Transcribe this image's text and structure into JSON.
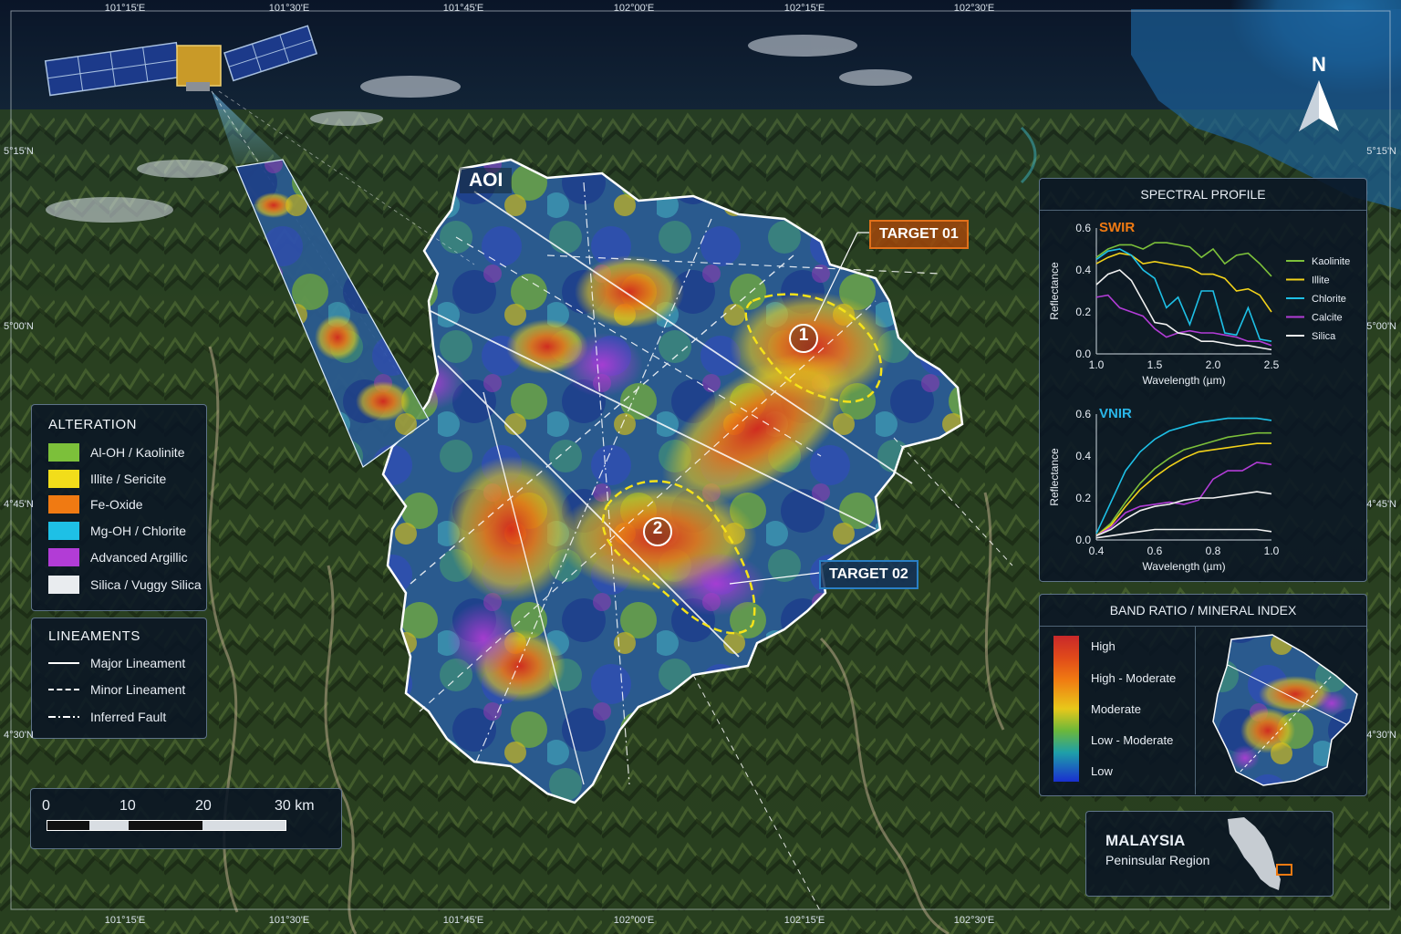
{
  "colors": {
    "kaolinite": "#7cc03a",
    "illite": "#f2dd1a",
    "fe_oxide": "#f07a12",
    "chlorite": "#1ec0e6",
    "argillic": "#b23cd6",
    "silica": "#e9ecef",
    "target01": "#e0701a",
    "target02": "#2a7fc4",
    "swir_title": "#f07a12",
    "vnir_title": "#2ab6e8"
  },
  "coords": {
    "lon_top": [
      "101°15'E",
      "101°30'E",
      "101°45'E",
      "102°00'E",
      "102°15'E",
      "102°30'E"
    ],
    "lon_bottom": [
      "101°15'E",
      "101°30'E",
      "101°45'E",
      "102°00'E",
      "102°15'E",
      "102°30'E"
    ],
    "lat_left": [
      "5°15'N",
      "5°00'N",
      "4°45'N",
      "4°30'N"
    ],
    "lat_right": [
      "5°15'N",
      "5°00'N",
      "4°45'N",
      "4°30'N"
    ]
  },
  "north_label": "N",
  "aoi_label": "AOI",
  "targets": [
    {
      "label": "TARGET 01",
      "marker": "1"
    },
    {
      "label": "TARGET 02",
      "marker": "2"
    }
  ],
  "alteration": {
    "title": "ALTERATION",
    "items": [
      {
        "label": "Al-OH / Kaolinite",
        "icon": "swatch-green"
      },
      {
        "label": "Illite / Sericite",
        "icon": "swatch-yellow"
      },
      {
        "label": "Fe-Oxide",
        "icon": "swatch-orange"
      },
      {
        "label": "Mg-OH / Chlorite",
        "icon": "swatch-cyan"
      },
      {
        "label": "Advanced Argillic",
        "icon": "swatch-purple"
      },
      {
        "label": "Silica / Vuggy Silica",
        "icon": "swatch-white"
      }
    ]
  },
  "lineaments": {
    "title": "LINEAMENTS",
    "items": [
      {
        "label": "Major Lineament",
        "style": "solid"
      },
      {
        "label": "Minor Lineament",
        "style": "dashed"
      },
      {
        "label": "Inferred Fault",
        "style": "dash-dot"
      }
    ]
  },
  "scalebar": {
    "ticks": [
      "0",
      "10",
      "20",
      "30 km"
    ]
  },
  "spectral": {
    "title": "SPECTRAL PROFILE",
    "swir": {
      "label": "SWIR",
      "ylabel": "Reflectance",
      "xlabel": "Wavelength (µm)",
      "xticks": [
        "1.0",
        "1.5",
        "2.0",
        "2.5"
      ],
      "yticks": [
        "0.0",
        "0.2",
        "0.4",
        "0.6"
      ]
    },
    "vnir": {
      "label": "VNIR",
      "ylabel": "Reflectance",
      "xlabel": "Wavelength (µm)",
      "xticks": [
        "0.4",
        "0.6",
        "0.8",
        "1.0"
      ],
      "yticks": [
        "0.0",
        "0.2",
        "0.4",
        "0.6"
      ]
    },
    "legend": [
      {
        "name": "Kaolinite",
        "color": "#7cc03a"
      },
      {
        "name": "Illite",
        "color": "#f2d21a"
      },
      {
        "name": "Chlorite",
        "color": "#1ec0e6"
      },
      {
        "name": "Calcite",
        "color": "#b23cd6"
      },
      {
        "name": "Silica",
        "color": "#f0f0f0"
      }
    ]
  },
  "band_ratio": {
    "title": "BAND RATIO / MINERAL INDEX",
    "classes": [
      {
        "label": "High",
        "color": "#c8282a"
      },
      {
        "label": "High - Moderate",
        "color": "#f07a12"
      },
      {
        "label": "Moderate",
        "color": "#e8c81a"
      },
      {
        "label": "Low - Moderate",
        "color": "#6cb83a"
      },
      {
        "label": "Low",
        "color": "#1a2fd0"
      }
    ]
  },
  "locator": {
    "country": "MALAYSIA",
    "region": "Peninsular Region"
  },
  "chart_data": [
    {
      "type": "line",
      "title": "SWIR",
      "xlabel": "Wavelength (µm)",
      "ylabel": "Reflectance",
      "xlim": [
        1.0,
        2.5
      ],
      "ylim": [
        0.0,
        0.6
      ],
      "x": [
        1.0,
        1.1,
        1.2,
        1.3,
        1.4,
        1.5,
        1.6,
        1.7,
        1.8,
        1.9,
        2.0,
        2.1,
        2.2,
        2.3,
        2.4,
        2.5
      ],
      "series": [
        {
          "name": "Kaolinite",
          "values": [
            0.46,
            0.5,
            0.52,
            0.52,
            0.5,
            0.53,
            0.53,
            0.52,
            0.51,
            0.46,
            0.5,
            0.43,
            0.47,
            0.48,
            0.43,
            0.37
          ]
        },
        {
          "name": "Illite",
          "values": [
            0.43,
            0.46,
            0.48,
            0.47,
            0.43,
            0.44,
            0.43,
            0.42,
            0.41,
            0.38,
            0.38,
            0.36,
            0.3,
            0.31,
            0.28,
            0.2
          ]
        },
        {
          "name": "Chlorite",
          "values": [
            0.45,
            0.49,
            0.5,
            0.47,
            0.4,
            0.36,
            0.22,
            0.27,
            0.14,
            0.3,
            0.3,
            0.1,
            0.09,
            0.22,
            0.07,
            0.06
          ]
        },
        {
          "name": "Calcite",
          "values": [
            0.27,
            0.28,
            0.22,
            0.2,
            0.18,
            0.12,
            0.08,
            0.1,
            0.11,
            0.1,
            0.1,
            0.09,
            0.08,
            0.06,
            0.06,
            0.04
          ]
        },
        {
          "name": "Silica",
          "values": [
            0.33,
            0.38,
            0.4,
            0.35,
            0.25,
            0.15,
            0.14,
            0.1,
            0.09,
            0.06,
            0.06,
            0.05,
            0.04,
            0.04,
            0.03,
            0.02
          ]
        }
      ]
    },
    {
      "type": "line",
      "title": "VNIR",
      "xlabel": "Wavelength (µm)",
      "ylabel": "Reflectance",
      "xlim": [
        0.4,
        1.0
      ],
      "ylim": [
        0.0,
        0.6
      ],
      "x": [
        0.4,
        0.45,
        0.5,
        0.55,
        0.6,
        0.65,
        0.7,
        0.75,
        0.8,
        0.85,
        0.9,
        0.95,
        1.0
      ],
      "series": [
        {
          "name": "Chlorite",
          "values": [
            0.03,
            0.18,
            0.33,
            0.42,
            0.48,
            0.52,
            0.54,
            0.56,
            0.57,
            0.58,
            0.58,
            0.58,
            0.57
          ]
        },
        {
          "name": "Kaolinite",
          "values": [
            0.02,
            0.08,
            0.18,
            0.27,
            0.34,
            0.39,
            0.43,
            0.45,
            0.47,
            0.49,
            0.5,
            0.51,
            0.51
          ]
        },
        {
          "name": "Illite",
          "values": [
            0.02,
            0.07,
            0.16,
            0.24,
            0.3,
            0.35,
            0.39,
            0.42,
            0.43,
            0.44,
            0.45,
            0.46,
            0.46
          ]
        },
        {
          "name": "Calcite",
          "values": [
            0.02,
            0.06,
            0.13,
            0.16,
            0.17,
            0.18,
            0.17,
            0.19,
            0.29,
            0.33,
            0.33,
            0.37,
            0.36
          ]
        },
        {
          "name": "Silica",
          "values": [
            0.02,
            0.05,
            0.1,
            0.14,
            0.16,
            0.17,
            0.19,
            0.2,
            0.2,
            0.21,
            0.22,
            0.23,
            0.22
          ]
        },
        {
          "name": "Silica-low",
          "values": [
            0.01,
            0.02,
            0.03,
            0.04,
            0.05,
            0.05,
            0.05,
            0.05,
            0.05,
            0.05,
            0.05,
            0.05,
            0.04
          ]
        }
      ]
    }
  ]
}
